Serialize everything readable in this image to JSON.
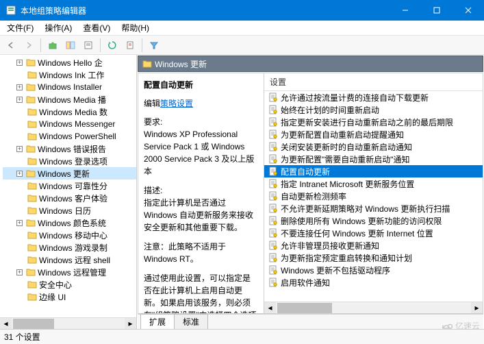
{
  "window": {
    "title": "本地组策略编辑器"
  },
  "menu": {
    "file": "文件(F)",
    "action": "操作(A)",
    "view": "查看(V)",
    "help": "帮助(H)"
  },
  "tree": {
    "items": [
      {
        "label": "Windows Hello 企",
        "exp": "+"
      },
      {
        "label": "Windows Ink 工作",
        "exp": ""
      },
      {
        "label": "Windows Installer",
        "exp": "+"
      },
      {
        "label": "Windows Media 播",
        "exp": "+"
      },
      {
        "label": "Windows Media 数",
        "exp": ""
      },
      {
        "label": "Windows Messenger",
        "exp": ""
      },
      {
        "label": "Windows PowerShell",
        "exp": ""
      },
      {
        "label": "Windows 错误报告",
        "exp": "+"
      },
      {
        "label": "Windows 登录选项",
        "exp": ""
      },
      {
        "label": "Windows 更新",
        "exp": "+",
        "selected": true
      },
      {
        "label": "Windows 可靠性分",
        "exp": ""
      },
      {
        "label": "Windows 客户体验",
        "exp": ""
      },
      {
        "label": "Windows 日历",
        "exp": ""
      },
      {
        "label": "Windows 颜色系统",
        "exp": "+"
      },
      {
        "label": "Windows 移动中心",
        "exp": ""
      },
      {
        "label": "Windows 游戏录制",
        "exp": ""
      },
      {
        "label": "Windows 远程 shell",
        "exp": ""
      },
      {
        "label": "Windows 远程管理",
        "exp": "+"
      },
      {
        "label": "安全中心",
        "exp": ""
      },
      {
        "label": "边缘 UI",
        "exp": ""
      }
    ]
  },
  "header": {
    "label": "Windows 更新"
  },
  "desc": {
    "title": "配置自动更新",
    "edit_prefix": "编辑",
    "edit_link": "策略设置",
    "req_h": "要求:",
    "req_body": "Windows XP Professional Service Pack 1 或 Windows 2000 Service Pack 3 及以上版本",
    "d_h": "描述:",
    "d1": "指定此计算机是否通过 Windows 自动更新服务来接收安全更新和其他重要下载。",
    "d2": "注意：此策略不适用于 Windows RT。",
    "d3": "通过使用此设置，可以指定是否在此计算机上启用自动更新。如果启用该服务，则必须在\"组策略设置\"中选择四个选项之一:"
  },
  "list": {
    "column": "设置",
    "items": [
      {
        "t": "允许通过按流量计费的连接自动下载更新"
      },
      {
        "t": "始终在计划的时间重新启动"
      },
      {
        "t": "指定更新安装进行自动重新启动之前的最后期限"
      },
      {
        "t": "为更新配置自动重新启动提醒通知"
      },
      {
        "t": "关闭安装更新时的自动重新启动通知"
      },
      {
        "t": "为更新配置\"需要自动重新启动\"通知"
      },
      {
        "t": "配置自动更新",
        "selected": true
      },
      {
        "t": "指定 Intranet Microsoft 更新服务位置"
      },
      {
        "t": "自动更新检测频率"
      },
      {
        "t": "不允许更新延期策略对 Windows 更新执行扫描"
      },
      {
        "t": "删除使用所有 Windows 更新功能的访问权限"
      },
      {
        "t": "不要连接任何 Windows 更新 Internet 位置"
      },
      {
        "t": "允许非管理员接收更新通知"
      },
      {
        "t": "为更新指定预定重启转换和通知计划"
      },
      {
        "t": "Windows 更新不包括驱动程序"
      },
      {
        "t": "启用软件通知"
      }
    ]
  },
  "tabs": {
    "t1": "扩展",
    "t2": "标准"
  },
  "status": {
    "text": "31 个设置"
  },
  "watermark": "亿速云"
}
